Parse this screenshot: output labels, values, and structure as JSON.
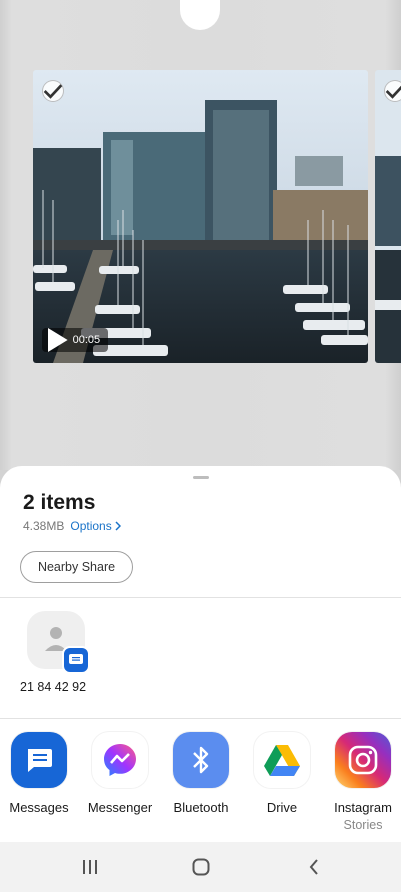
{
  "preview": {
    "duration": "00:05",
    "selected": true
  },
  "sheet": {
    "title": "2 items",
    "size": "4.38MB",
    "options_label": "Options",
    "nearby_share_label": "Nearby Share"
  },
  "contacts": [
    {
      "name": "21 84 42 92",
      "app": "Messages"
    }
  ],
  "apps": [
    {
      "label": "Messages",
      "sub": "",
      "icon": "messages-icon"
    },
    {
      "label": "Messenger",
      "sub": "",
      "icon": "messenger-icon"
    },
    {
      "label": "Bluetooth",
      "sub": "",
      "icon": "bluetooth-icon"
    },
    {
      "label": "Drive",
      "sub": "",
      "icon": "drive-icon"
    },
    {
      "label": "Instagram",
      "sub": "Stories",
      "icon": "instagram-icon"
    }
  ],
  "navbar": {
    "recents": "recents-icon",
    "home": "home-icon",
    "back": "back-icon"
  },
  "colors": {
    "accent": "#1a73c8",
    "messages": "#1766d6",
    "bluetooth": "#5b8def"
  }
}
